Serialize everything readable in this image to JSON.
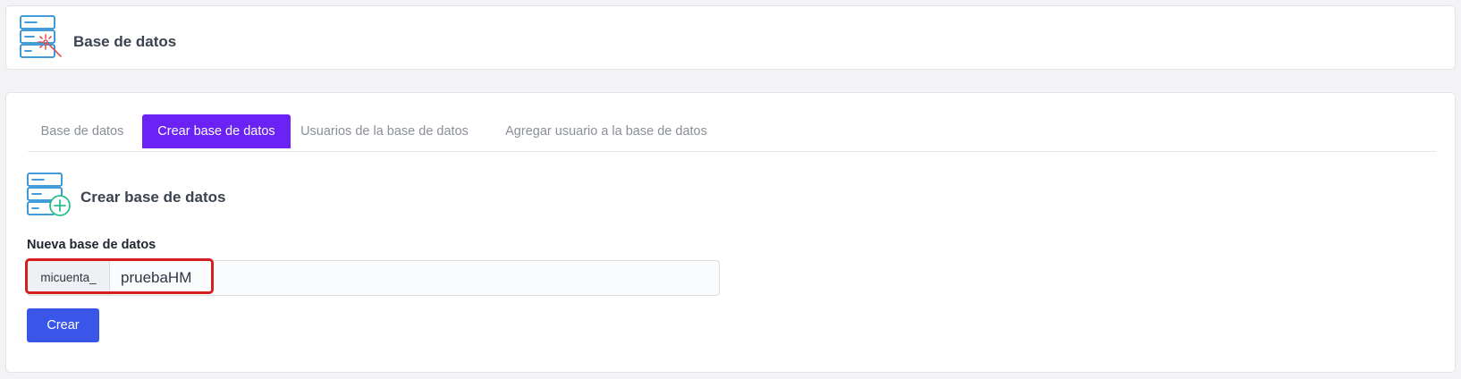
{
  "header": {
    "title": "Base de datos",
    "icon": "database-magic-icon"
  },
  "tabs": [
    {
      "label": "Base de datos",
      "active": false
    },
    {
      "label": "Crear base de datos",
      "active": true
    },
    {
      "label": "Usuarios de la base de datos",
      "active": false
    },
    {
      "label": "Agregar usuario a la base de datos",
      "active": false
    }
  ],
  "section": {
    "title": "Crear base de datos",
    "icon": "database-add-icon"
  },
  "form": {
    "label": "Nueva base de datos",
    "prefix": "micuenta_",
    "value": "pruebaHM",
    "submit_label": "Crear"
  },
  "colors": {
    "tab_active": "#6a22f5",
    "button": "#3a56e8",
    "highlight": "#d41f1f",
    "icon_blue": "#2b8fd6",
    "icon_red": "#e05252",
    "icon_green": "#27c08a"
  }
}
